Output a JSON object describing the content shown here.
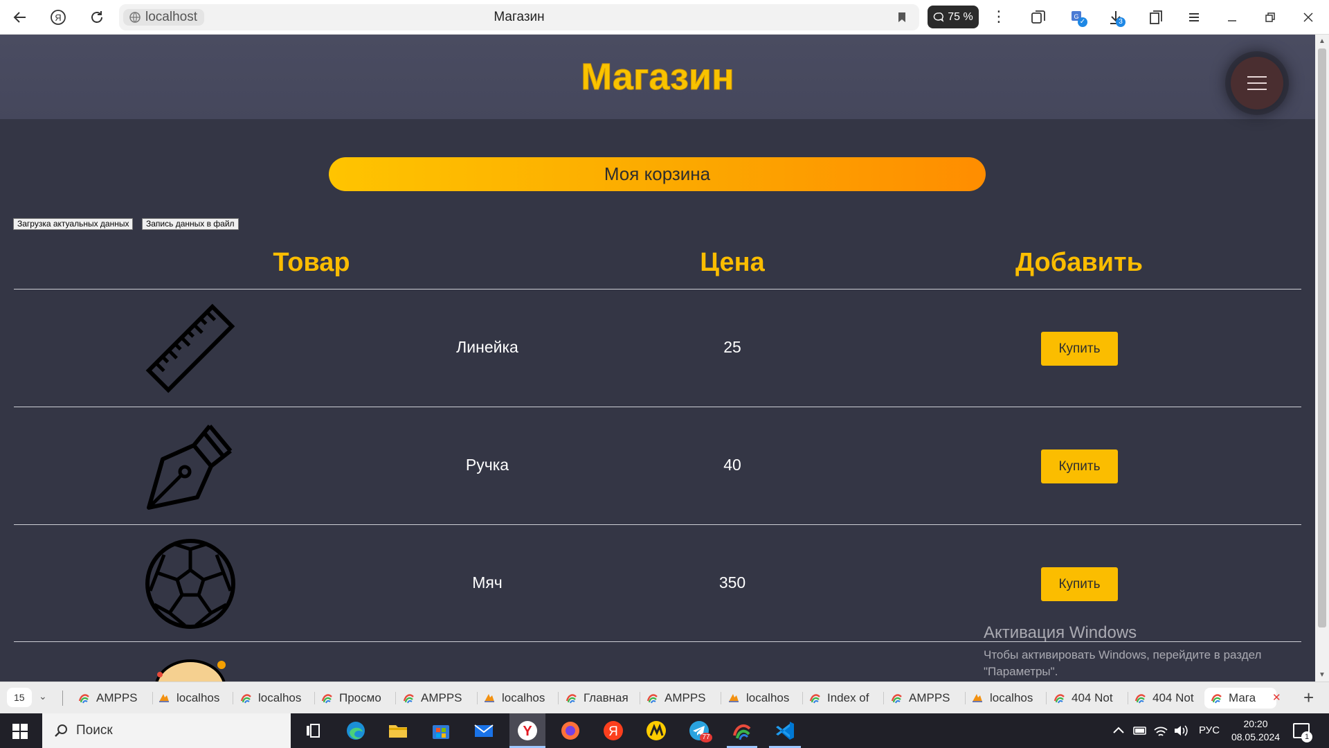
{
  "browser": {
    "url": "localhost",
    "tab_title": "Магазин",
    "zoom": "75 %",
    "downloads_badge": "3"
  },
  "site": {
    "title": "Магазин",
    "cart_label": "Моя корзина",
    "load_button": "Загрузка актуальных данных",
    "save_button": "Запись данных в файл"
  },
  "table": {
    "headers": [
      "Товар",
      "Цена",
      "Добавить"
    ],
    "rows": [
      {
        "name": "Линейка",
        "price": "25",
        "buy": "Купить",
        "icon": "ruler-icon"
      },
      {
        "name": "Ручка",
        "price": "40",
        "buy": "Купить",
        "icon": "pen-nib-icon"
      },
      {
        "name": "Мяч",
        "price": "350",
        "buy": "Купить",
        "icon": "soccer-ball-icon"
      }
    ]
  },
  "watermark": {
    "title": "Активация Windows",
    "line1": "Чтобы активировать Windows, перейдите в раздел",
    "line2": "\"Параметры\"."
  },
  "tabs": {
    "count": "15",
    "items": [
      {
        "label": "AMPPS",
        "icon": "ampps-icon"
      },
      {
        "label": "localhos",
        "icon": "phpmyadmin-icon"
      },
      {
        "label": "localhos",
        "icon": "ampps-icon"
      },
      {
        "label": "Просмо",
        "icon": "ampps-icon"
      },
      {
        "label": "AMPPS",
        "icon": "ampps-icon"
      },
      {
        "label": "localhos",
        "icon": "phpmyadmin-icon"
      },
      {
        "label": "Главная",
        "icon": "ampps-icon"
      },
      {
        "label": "AMPPS",
        "icon": "ampps-icon"
      },
      {
        "label": "localhos",
        "icon": "phpmyadmin-icon"
      },
      {
        "label": "Index of",
        "icon": "ampps-icon"
      },
      {
        "label": "AMPPS",
        "icon": "ampps-icon"
      },
      {
        "label": "localhos",
        "icon": "phpmyadmin-icon"
      },
      {
        "label": "404 Not",
        "icon": "ampps-icon"
      },
      {
        "label": "404 Not",
        "icon": "ampps-icon"
      },
      {
        "label": "Мага",
        "icon": "ampps-icon"
      }
    ]
  },
  "taskbar": {
    "search_placeholder": "Поиск",
    "telegram_badge": "77",
    "language": "РУС",
    "time": "20:20",
    "date": "08.05.2024",
    "notification_count": "1"
  },
  "colors": {
    "accent": "#fbbd00",
    "page_bg": "#343645",
    "header_bg": "#4a4c61",
    "burger_bg": "#4a2e30"
  }
}
